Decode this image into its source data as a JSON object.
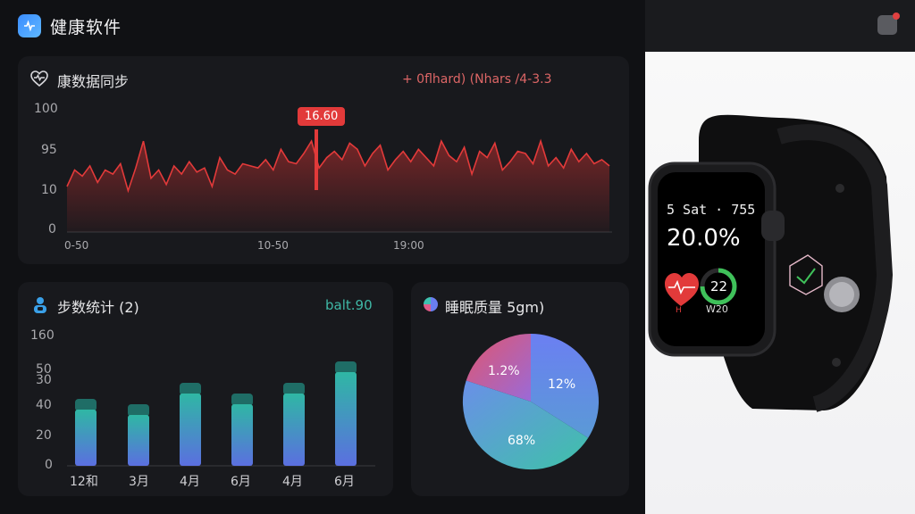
{
  "header": {
    "title": "健康软件"
  },
  "heart_card": {
    "title": "康数据同步",
    "legend": "+ 0flhard) (Nhars /4-3.3",
    "tooltip": "16.60",
    "y_ticks": [
      "100",
      "95",
      "10",
      "0"
    ],
    "x_ticks": [
      "0-50",
      "10-50",
      "19:00"
    ]
  },
  "steps_card": {
    "title": "步数统计 (2)",
    "value": "balt.90",
    "y_ticks": [
      "160",
      "50",
      "30",
      "40",
      "20",
      "0"
    ],
    "categories": [
      "12和",
      "3月",
      "4月",
      "6月",
      "4月",
      "6月"
    ]
  },
  "sleep_card": {
    "title": "睡眠质量 5gm)",
    "slices": [
      "1.2%",
      "12%",
      "68%"
    ]
  },
  "watch": {
    "line1": "5 Sat · 755",
    "time": "20.0%",
    "ring_value": "22",
    "ring_sub": "W20",
    "heart_sub": "H"
  },
  "colors": {
    "accent_red": "#e23a3a",
    "teal": "#3fb8a6",
    "bar_top": "#2fa5a0",
    "bar_bottom": "#5b6fe0"
  },
  "chart_data": [
    {
      "type": "line",
      "title": "康数据同步",
      "y_ticks": [
        "100",
        "95",
        "10",
        "0"
      ],
      "x_ticks": [
        "0-50",
        "10-50",
        "19:00"
      ],
      "series": [
        {
          "name": "0flhard",
          "values": [
            62,
            70,
            67,
            72,
            64,
            70,
            68,
            73,
            60,
            71,
            84,
            66,
            70,
            63,
            72,
            68,
            74,
            69,
            71,
            62,
            76,
            70,
            68,
            73,
            72,
            71,
            75,
            70,
            80,
            74,
            73,
            78,
            84,
            71,
            76,
            79,
            75,
            83,
            80,
            72,
            78,
            82,
            70,
            75,
            79,
            74,
            80,
            76,
            72,
            84,
            77,
            74,
            81,
            68,
            79,
            76,
            83,
            70,
            74,
            79,
            78,
            73,
            84,
            72,
            76,
            71,
            80,
            74,
            78,
            73,
            75,
            72
          ]
        }
      ],
      "annotation": "16.60"
    },
    {
      "type": "bar",
      "title": "步数统计 (2)",
      "categories": [
        "12和",
        "3月",
        "4月",
        "6月",
        "4月",
        "6月"
      ],
      "values": [
        50,
        46,
        62,
        54,
        62,
        78
      ]
    },
    {
      "type": "pie",
      "title": "睡眠质量 5gm)",
      "labels": [
        "1.2%",
        "12%",
        "68%"
      ],
      "values": [
        20,
        34,
        46
      ]
    }
  ]
}
